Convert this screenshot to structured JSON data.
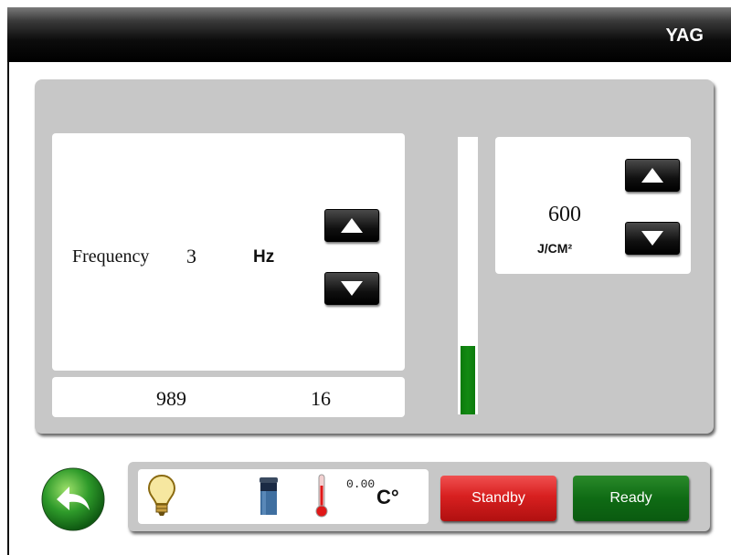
{
  "header": {
    "title": "YAG"
  },
  "frequency": {
    "label": "Frequency",
    "value": "3",
    "unit": "Hz"
  },
  "counters": {
    "left": "989",
    "right": "16"
  },
  "energy": {
    "value": "600",
    "unit": "J/CM²",
    "level_fraction": 0.25,
    "bar_color": "#138a13"
  },
  "status": {
    "temperature": "0.00",
    "temp_unit": "C°"
  },
  "buttons": {
    "standby_label": "Standby",
    "ready_label": "Ready"
  },
  "icons": [
    "back-arrow-icon",
    "lightbulb-icon",
    "water-tank-icon",
    "thermometer-icon",
    "arrow-up-icon",
    "arrow-down-icon"
  ],
  "colors": {
    "standby": "#d82020",
    "ready": "#0f6b14",
    "title_bar": "#000000",
    "panel": "#c7c7c7"
  }
}
